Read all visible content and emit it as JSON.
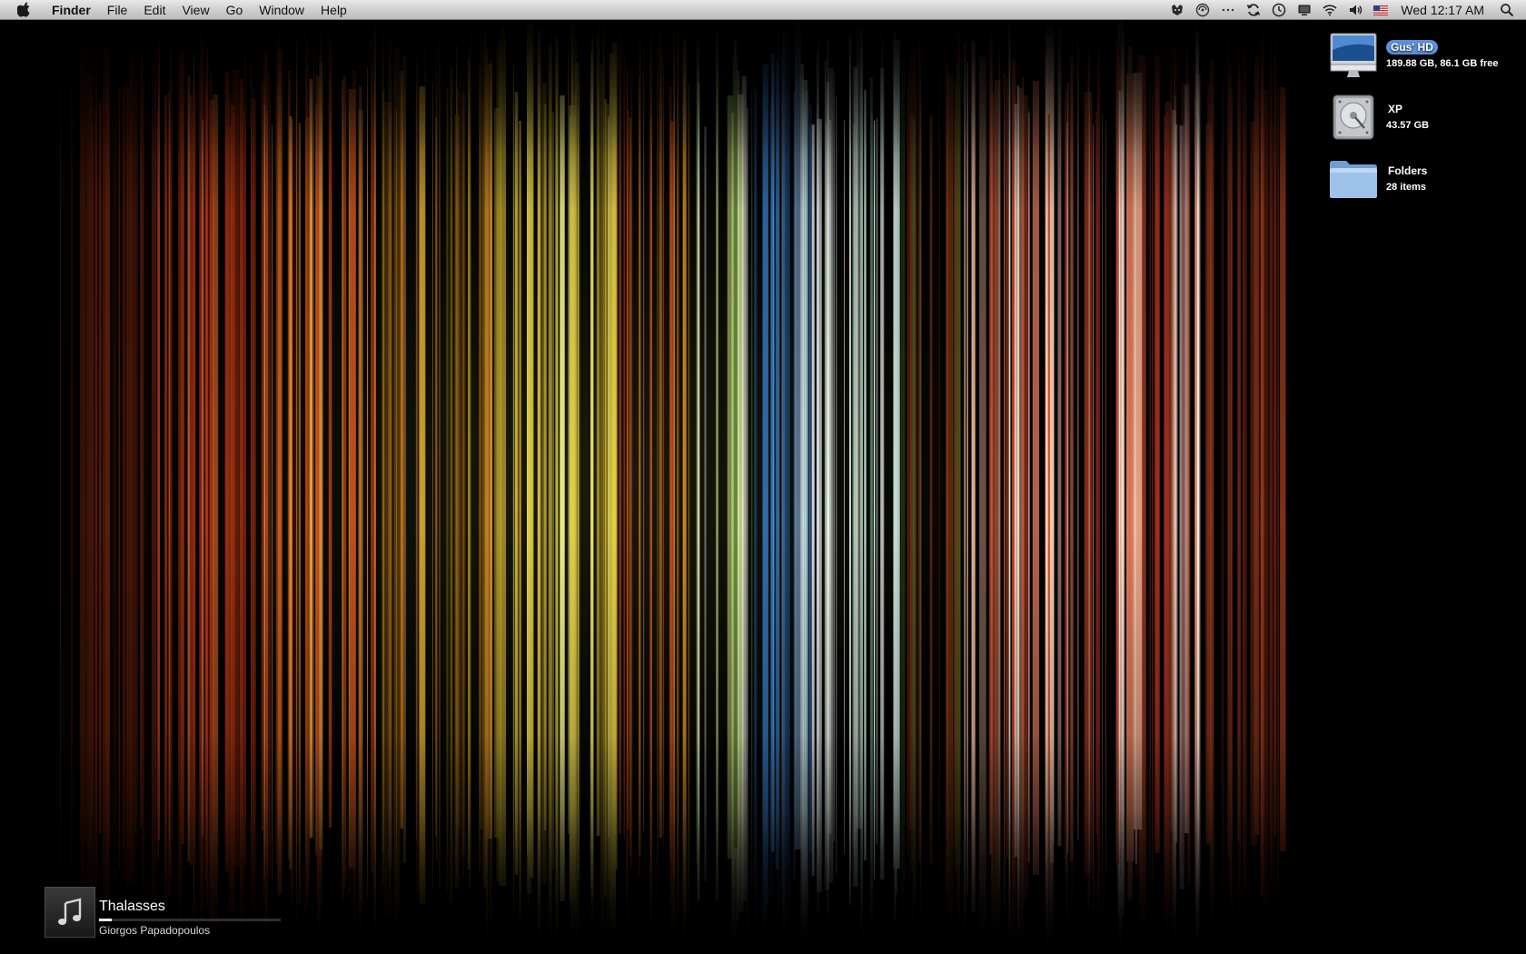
{
  "menubar": {
    "app_name": "Finder",
    "menus": [
      "File",
      "Edit",
      "View",
      "Go",
      "Window",
      "Help"
    ],
    "status_icons": [
      "growl-icon",
      "sync-ball-icon",
      "dots-icon",
      "sync-icon",
      "time-machine-icon",
      "display-icon",
      "wifi-icon",
      "volume-icon",
      "us-flag-icon"
    ],
    "clock": "Wed 12:17 AM"
  },
  "desktop": {
    "icons": [
      {
        "name": "Gus' HD",
        "info": "189.88 GB, 86.1 GB free",
        "icon": "imac-icon",
        "selected": true
      },
      {
        "name": "XP",
        "info": "43.57 GB",
        "icon": "hard-drive-icon",
        "selected": false
      },
      {
        "name": "Folders",
        "info": "28 items",
        "icon": "folder-icon",
        "selected": false
      }
    ]
  },
  "now_playing": {
    "title": "Thalasses",
    "artist": "Giorgos Papadopoulos",
    "progress": 0.07,
    "art_icon": "music-note-icon"
  },
  "colors": {
    "selection": "#5b8fd9",
    "menubar": "#d4d4d4"
  }
}
